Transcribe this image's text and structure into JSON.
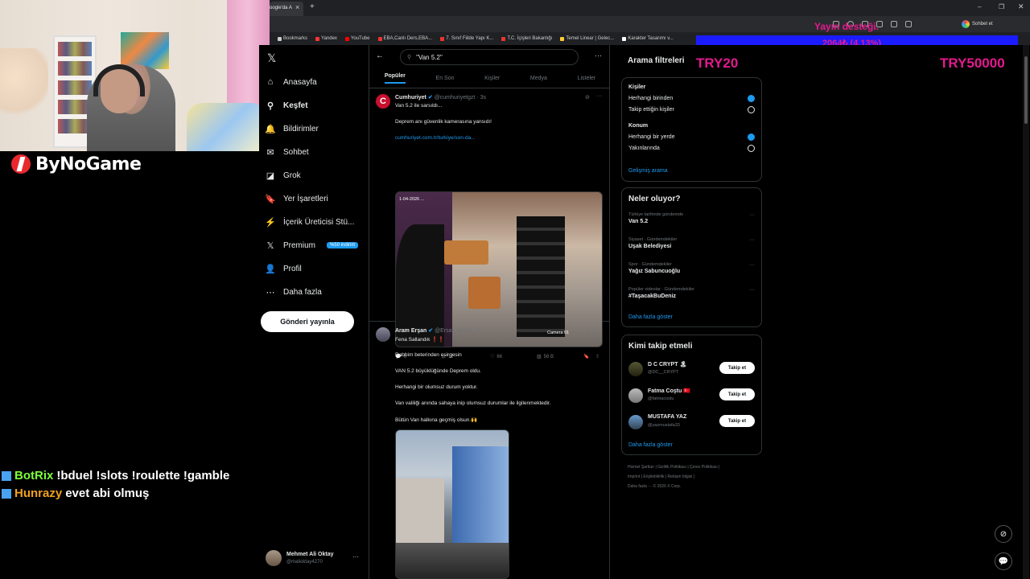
{
  "browser": {
    "tab_title": "oogle'da A",
    "tab_close": "×",
    "new_tab": "+",
    "profile_label": "Sohbet et",
    "bookmarks": [
      "Bookmarks",
      "Yandex",
      "YouTube",
      "EBA,Canlı Ders,EBA...",
      "7. Sınıf Fiilde Yapı K...",
      "T.C. İçişleri Bakanlığı",
      "Temel Linear | Gelec...",
      "Karakter Tasarımı v..."
    ]
  },
  "stream": {
    "logo_text": "ByNoGame",
    "chat": [
      {
        "user": "BotRix",
        "user_color": "#7cff3a",
        "message": "!bduel !slots !roulette !gamble"
      },
      {
        "user": "Hunrazy",
        "user_color": "#f0a01e",
        "message": "evet abi olmuş"
      }
    ],
    "donation_title": "Yayın desteği.",
    "donation_amount": "2064₺ (4.13%)",
    "donation_min": "TRY20",
    "donation_goal": "TRY50000"
  },
  "nav": {
    "logo": "𝕏",
    "items": [
      {
        "label": "Anasayfa",
        "icon": "⌂"
      },
      {
        "label": "Keşfet",
        "icon": "⚲"
      },
      {
        "label": "Bildirimler",
        "icon": "🔔"
      },
      {
        "label": "Sohbet",
        "icon": "✉"
      },
      {
        "label": "Grok",
        "icon": "◪"
      },
      {
        "label": "Yer İşaretleri",
        "icon": "🔖"
      },
      {
        "label": "İçerik Üreticisi Stü...",
        "icon": "⚡"
      },
      {
        "label": "Premium",
        "icon": "𝕏"
      },
      {
        "label": "Profil",
        "icon": "👤"
      },
      {
        "label": "Daha fazla",
        "icon": "⋯"
      }
    ],
    "premium_badge": "%50 indirim",
    "post_button": "Gönderi yayınla",
    "account_name": "Mehmet Ali Oktay",
    "account_handle": "@malioktay4270",
    "account_more": "···"
  },
  "search": {
    "back": "←",
    "query": "\"Van 5.2\"",
    "more": "···",
    "tabs": [
      "Popüler",
      "En Son",
      "Kişiler",
      "Medya",
      "Listeler"
    ]
  },
  "tweets": [
    {
      "name": "Cumhuriyet",
      "handle": "@cumhuriyetgzt · 3s",
      "lines": [
        "Van 5.2 ile sarsıldı...",
        "Deprem anı güvenlik kamerasına yansıdı!"
      ],
      "link": "cumhuriyet.com.tr/turkiye/son-da...",
      "media_overlay": "Camera 01",
      "media_timestamp": "1-04-2026 ...",
      "replies": "6",
      "reposts": "11",
      "likes": "66",
      "views": "56 B"
    },
    {
      "name": "Aram Erşan",
      "handle": "@Ersan_Aram · 4s",
      "lines": [
        "Fena Sallandık ❗❗",
        "Rabbim beterinden esirgesin",
        "VAN 5.2 büyüklüğünde Deprem oldu.",
        "Herhangi bir olumsuz durum yoktur.",
        "Van valiliği anında sahaya inip olumsuz durumlar ile ilgilenmektedir.",
        "Bütün Van halkına geçmiş olsun.🙌"
      ]
    }
  ],
  "filters": {
    "title": "Arama filtreleri",
    "people_heading": "Kişiler",
    "people_options": [
      "Herhangi birinden",
      "Takip ettiğin kişiler"
    ],
    "location_heading": "Konum",
    "location_options": [
      "Herhangi bir yerde",
      "Yakınlarında"
    ],
    "advanced_link": "Gelişmiş arama"
  },
  "trends": {
    "title": "Neler oluyor?",
    "items": [
      {
        "context": "Türkiye tarihinde gündemde",
        "name": "Van 5.2"
      },
      {
        "context": "Siyaset · Gündemdekiler",
        "name": "Uşak Belediyesi"
      },
      {
        "context": "Spor · Gündemdekiler",
        "name": "Yağız Sabuncuoğlu"
      },
      {
        "context": "Popüler videolar · Gündemdekiler",
        "name": "#TaşacakBuDeniz"
      }
    ],
    "show_more": "Daha fazla göster"
  },
  "who_to_follow": {
    "title": "Kimi takip etmeli",
    "users": [
      {
        "name": "D C CRYPT 🏝",
        "handle": "@DC__CRYPT"
      },
      {
        "name": "Fatma Coştu 🇹🇷",
        "handle": "@fatmacostu"
      },
      {
        "name": "MUSTAFA YAZ",
        "handle": "@yazmustafa33"
      }
    ],
    "follow_label": "Takip et",
    "show_more": "Daha fazla göster"
  },
  "footer": {
    "line1": "Hizmet Şartları | Gizlilik Politikası | Çerez Politikası |",
    "line2": "Imprint | Erişilebilirlik | Reklam bilgisi |",
    "line3": "Daha fazla ··· © 2026 X Corp."
  }
}
